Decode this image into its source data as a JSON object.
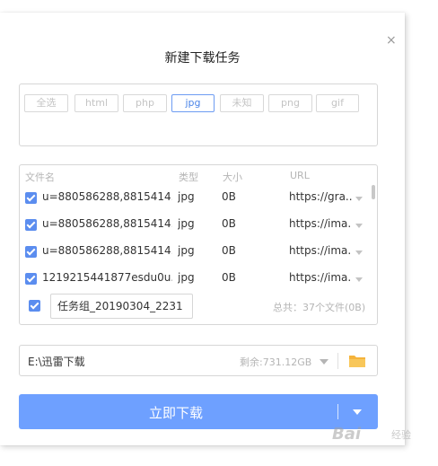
{
  "dialog": {
    "title": "新建下载任务",
    "close_glyph": "×"
  },
  "filters": [
    {
      "label": "全选",
      "active": false
    },
    {
      "label": "html",
      "active": false
    },
    {
      "label": "php",
      "active": false
    },
    {
      "label": "jpg",
      "active": true
    },
    {
      "label": "未知",
      "active": false
    },
    {
      "label": "png",
      "active": false
    },
    {
      "label": "gif",
      "active": false
    }
  ],
  "file_list": {
    "headers": {
      "name": "文件名",
      "type": "类型",
      "size": "大小",
      "url": "URL"
    },
    "rows": [
      {
        "checked": true,
        "name": "u=880586288,8815414...",
        "type": "jpg",
        "size": "0B",
        "url": "https://gra..."
      },
      {
        "checked": true,
        "name": "u=880586288,8815414...",
        "type": "jpg",
        "size": "0B",
        "url": "https://ima..."
      },
      {
        "checked": true,
        "name": "u=880586288,8815414...",
        "type": "jpg",
        "size": "0B",
        "url": "https://ima..."
      },
      {
        "checked": true,
        "name": "1219215441877esdu0u...",
        "type": "jpg",
        "size": "0B",
        "url": "https://ima..."
      }
    ],
    "group_checked": true,
    "group_name": "任务组_20190304_2231",
    "total": "总共：37个文件(0B)"
  },
  "save_path": {
    "path": "E:\\迅雷下载",
    "remaining": "剩余:731.12GB",
    "folder_icon": "folder-icon"
  },
  "download_button": {
    "label": "立即下载"
  },
  "watermark": {
    "text": "Bai",
    "sub": "经验"
  },
  "colors": {
    "accent": "#6ea0ff",
    "checkbox": "#5b8def",
    "active_chip": "#4a84e8",
    "folder": "#f5b33b"
  }
}
